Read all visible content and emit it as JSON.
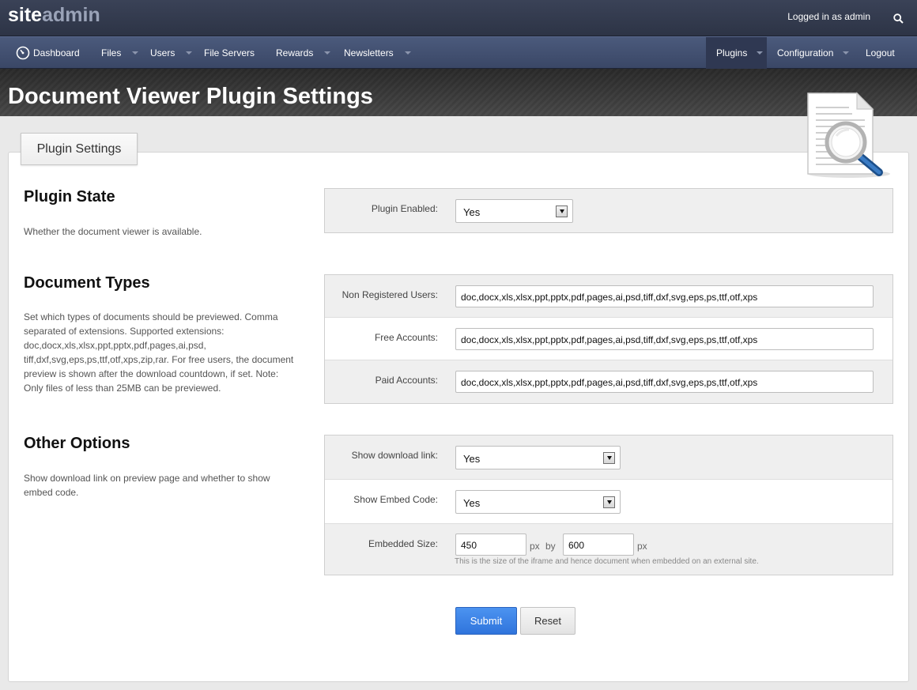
{
  "app": {
    "logo_primary": "site",
    "logo_secondary": "admin",
    "logged_in_text": "Logged in as admin"
  },
  "nav": {
    "items": [
      {
        "label": "Dashboard"
      },
      {
        "label": "Files"
      },
      {
        "label": "Users"
      },
      {
        "label": "File Servers"
      },
      {
        "label": "Rewards"
      },
      {
        "label": "Newsletters"
      }
    ],
    "right_items": [
      {
        "label": "Plugins"
      },
      {
        "label": "Configuration"
      },
      {
        "label": "Logout"
      }
    ],
    "active": "Plugins"
  },
  "page": {
    "title": "Document Viewer Plugin Settings",
    "tab": "Plugin Settings"
  },
  "sections": {
    "plugin_state": {
      "title": "Plugin State",
      "description": "Whether the document viewer is available.",
      "fields": {
        "plugin_enabled_label": "Plugin Enabled:",
        "plugin_enabled_value": "Yes"
      }
    },
    "document_types": {
      "title": "Document Types",
      "description": "Set which types of documents should be previewed. Comma separated of extensions. Supported extensions: doc,docx,xls,xlsx,ppt,pptx,pdf,pages,ai,psd, tiff,dxf,svg,eps,ps,ttf,otf,xps,zip,rar. For free users, the document preview is shown after the download countdown, if set. Note: Only files of less than 25MB can be previewed.",
      "fields": {
        "non_registered_label": "Non Registered Users:",
        "non_registered_value": "doc,docx,xls,xlsx,ppt,pptx,pdf,pages,ai,psd,tiff,dxf,svg,eps,ps,ttf,otf,xps",
        "free_label": "Free Accounts:",
        "free_value": "doc,docx,xls,xlsx,ppt,pptx,pdf,pages,ai,psd,tiff,dxf,svg,eps,ps,ttf,otf,xps",
        "paid_label": "Paid Accounts:",
        "paid_value": "doc,docx,xls,xlsx,ppt,pptx,pdf,pages,ai,psd,tiff,dxf,svg,eps,ps,ttf,otf,xps"
      }
    },
    "other_options": {
      "title": "Other Options",
      "description": "Show download link on preview page and whether to show embed code.",
      "fields": {
        "show_download_label": "Show download link:",
        "show_download_value": "Yes",
        "show_embed_label": "Show Embed Code:",
        "show_embed_value": "Yes",
        "embedded_size_label": "Embedded Size:",
        "width_value": "450",
        "width_unit": "px",
        "by_text": "by",
        "height_value": "600",
        "height_unit": "px",
        "embedded_hint": "This is the size of the iframe and hence document when embedded on an external site."
      }
    }
  },
  "buttons": {
    "submit": "Submit",
    "reset": "Reset"
  },
  "colors": {
    "topbar": "#2d3446",
    "navbar": "#3a4766",
    "accent_button": "#2f74dc"
  }
}
